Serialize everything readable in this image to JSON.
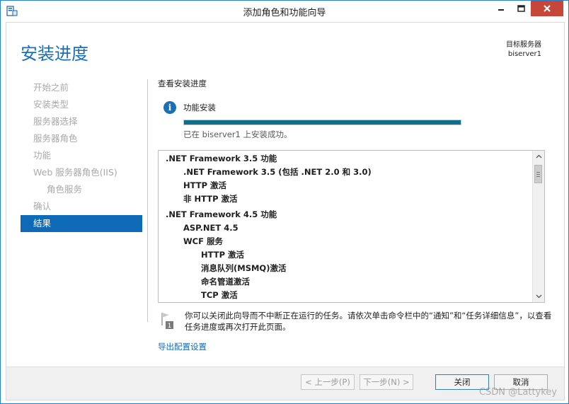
{
  "window": {
    "title": "添加角色和功能向导",
    "app_icon": "server-manager-icon",
    "controls": [
      "minimize-icon",
      "maximize-icon",
      "close-icon"
    ]
  },
  "page": {
    "heading": "安装进度",
    "target_label": "目标服务器",
    "target_server": "biserver1"
  },
  "nav": {
    "items": [
      {
        "label": "开始之前",
        "state": "disabled"
      },
      {
        "label": "安装类型",
        "state": "disabled"
      },
      {
        "label": "服务器选择",
        "state": "disabled"
      },
      {
        "label": "服务器角色",
        "state": "disabled"
      },
      {
        "label": "功能",
        "state": "disabled"
      },
      {
        "label": "Web 服务器角色(IIS)",
        "state": "disabled"
      },
      {
        "label": "角色服务",
        "state": "disabled"
      },
      {
        "label": "确认",
        "state": "disabled"
      },
      {
        "label": "结果",
        "state": "active"
      }
    ]
  },
  "main": {
    "section_label": "查看安装进度",
    "feature_install_label": "功能安装",
    "progress": 1.0,
    "success_text": "已在 biserver1 上安装成功。",
    "tree": [
      ".NET Framework 3.5 功能",
      ".NET Framework 3.5 (包括 .NET 2.0 和 3.0)",
      "HTTP 激活",
      "非 HTTP 激活",
      ".NET Framework 4.5 功能",
      "ASP.NET 4.5",
      "WCF 服务",
      "HTTP 激活",
      "消息队列(MSMQ)激活",
      "命名管道激活",
      "TCP 激活"
    ],
    "note_text": "你可以关闭此向导而不中断正在运行的任务。请依次单击命令栏中的“通知”和“任务详细信息”，以查看任务进度或再次打开此页面。",
    "note_badge": "1",
    "export_link": "导出配置设置"
  },
  "footer": {
    "prev": "< 上一步(P)",
    "next": "下一步(N) >",
    "close": "关闭",
    "cancel": "取消"
  },
  "watermark": "CSDN @Lattykey"
}
